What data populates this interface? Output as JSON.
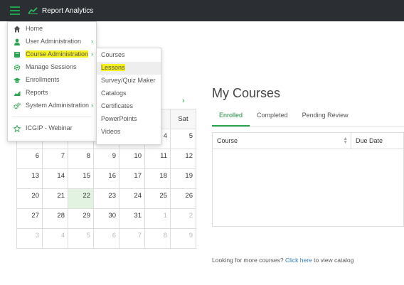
{
  "topbar": {
    "brand": "Report Analytics",
    "menu_icon": "hamburger-icon",
    "brand_icon": "line-chart-icon"
  },
  "main_menu": {
    "items": [
      {
        "label": "Home",
        "icon": "home-icon"
      },
      {
        "label": "User Administration",
        "icon": "user-icon",
        "has_submenu": true
      },
      {
        "label": "Course Administration",
        "icon": "book-icon",
        "has_submenu": true,
        "highlighted": true
      },
      {
        "label": "Manage Sessions",
        "icon": "gear-icon"
      },
      {
        "label": "Enrollments",
        "icon": "graduation-cap-icon"
      },
      {
        "label": "Reports",
        "icon": "area-chart-icon"
      },
      {
        "label": "System Administration",
        "icon": "gears-icon",
        "has_submenu": true
      },
      {
        "label": "ICGIP - Webinar",
        "icon": "star-icon"
      }
    ]
  },
  "sub_menu": {
    "items": [
      "Courses",
      "Lessons",
      "Survey/Quiz Maker",
      "Catalogs",
      "Certificates",
      "PowerPoints",
      "Videos"
    ],
    "hovered": "Lessons"
  },
  "calendar": {
    "header_visible": "Sat",
    "row0": [
      "4",
      "5"
    ],
    "rows": [
      [
        "6",
        "7",
        "8",
        "9",
        "10",
        "11",
        "12"
      ],
      [
        "13",
        "14",
        "15",
        "16",
        "17",
        "18",
        "19"
      ],
      [
        "20",
        "21",
        "22",
        "23",
        "24",
        "25",
        "26"
      ],
      [
        "27",
        "28",
        "29",
        "30",
        "31",
        "1",
        "2"
      ],
      [
        "3",
        "4",
        "5",
        "6",
        "7",
        "8",
        "9"
      ]
    ],
    "today": "22"
  },
  "my_courses": {
    "title": "My Courses",
    "tabs": [
      "Enrolled",
      "Completed",
      "Pending Review"
    ],
    "active_tab": "Enrolled",
    "columns": [
      "Course",
      "Due Date"
    ],
    "footer_prefix": "Looking for more courses? ",
    "footer_link": "Click here",
    "footer_suffix": " to view catalog"
  },
  "colors": {
    "topbar": "#2b2f33",
    "accent_green": "#1ea34a",
    "highlight": "#f6f01d",
    "link": "#2a7bbd"
  }
}
